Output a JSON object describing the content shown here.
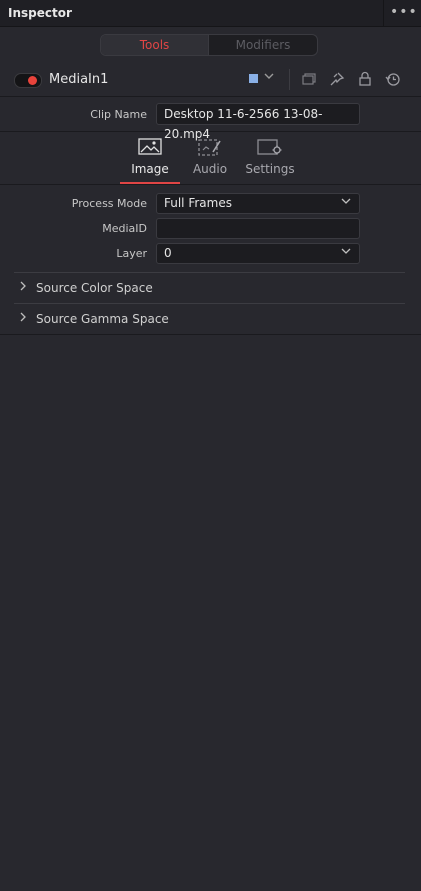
{
  "panel": {
    "title": "Inspector",
    "more_label": "•••"
  },
  "mode_tabs": {
    "tools": "Tools",
    "modifiers": "Modifiers"
  },
  "tool": {
    "name": "MediaIn1",
    "enabled": true,
    "color_chip": "#8ab0e6",
    "icons": [
      "version-icon",
      "pin-icon",
      "lock-icon",
      "reset-icon"
    ]
  },
  "clip": {
    "label": "Clip Name",
    "value": "Desktop 11-6-2566 13-08-20.mp4"
  },
  "sub_tabs": [
    {
      "label": "Image",
      "icon": "image-icon",
      "active": true
    },
    {
      "label": "Audio",
      "icon": "audio-icon",
      "active": false
    },
    {
      "label": "Settings",
      "icon": "settings-icon",
      "active": false
    }
  ],
  "fields": {
    "process_mode": {
      "label": "Process Mode",
      "value": "Full Frames"
    },
    "media_id": {
      "label": "MediaID",
      "value": ""
    },
    "layer": {
      "label": "Layer",
      "value": "0"
    }
  },
  "sections": [
    {
      "label": "Source Color Space"
    },
    {
      "label": "Source Gamma Space"
    }
  ],
  "colors": {
    "accent": "#e04545",
    "background": "#28282e",
    "toggle_on": "#e8433b"
  }
}
